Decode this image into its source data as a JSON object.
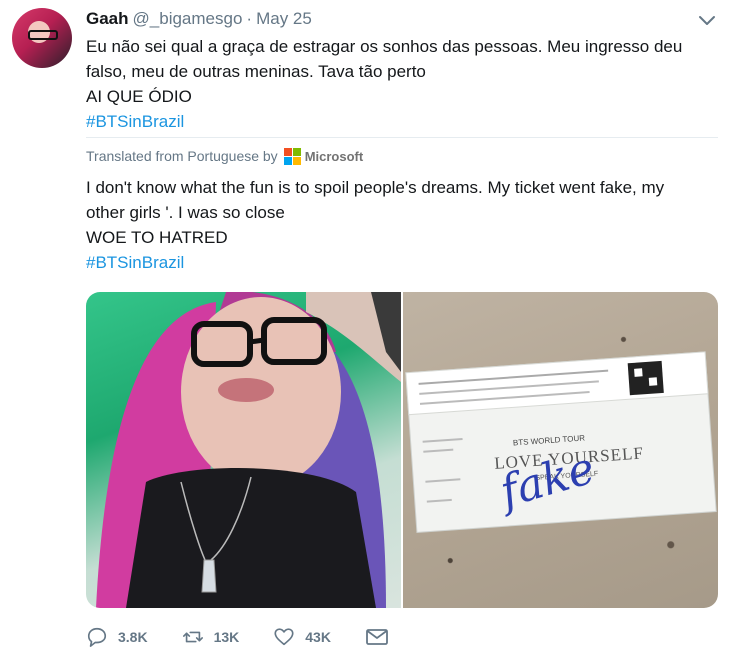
{
  "tweet": {
    "author_name": "Gaah",
    "author_handle": "@_bigamesgo",
    "separator": "·",
    "date": "May 25",
    "text_lines": [
      "Eu não sei qual a graça de estragar os sonhos das pessoas. Meu ingresso deu",
      "falso, meu de outras meninas. Tava tão perto",
      "AI QUE ÓDIO"
    ],
    "hashtag": "#BTSinBrazil"
  },
  "translation": {
    "label": "Translated from Portuguese by",
    "provider": "Microsoft",
    "text_lines": [
      "I don't know what the fun is to spoil people's dreams. My ticket went fake, my",
      "other girls '. I was so close",
      "WOE TO HATRED"
    ],
    "hashtag": "#BTSinBrazil"
  },
  "ticket": {
    "line1": "BTS WORLD TOUR",
    "line2": "LOVE YOURSELF",
    "line3": "SPEAK YOURSELF",
    "handwriting": "fake"
  },
  "actions": {
    "replies": "3.8K",
    "retweets": "13K",
    "likes": "43K"
  },
  "icons": {
    "menu": "chevron-down-icon",
    "reply": "reply-icon",
    "retweet": "retweet-icon",
    "like": "heart-icon",
    "dm": "envelope-icon"
  },
  "colors": {
    "link": "#1b95e0",
    "muted": "#657786",
    "text": "#14171a",
    "ms_red": "#f25022",
    "ms_green": "#7fba00",
    "ms_blue": "#00a4ef",
    "ms_yellow": "#ffb900"
  }
}
